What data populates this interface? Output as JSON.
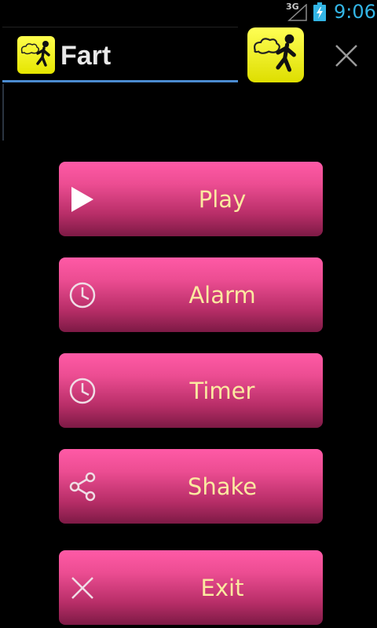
{
  "status_bar": {
    "network": "3G",
    "time": "9:06",
    "signal_icon": "signal-icon",
    "battery_icon": "battery-charging-icon"
  },
  "ad_bar": {
    "title": "Fart",
    "icon": "fart-man-icon",
    "close_icon": "close-icon"
  },
  "menu": {
    "items": [
      {
        "label": "Play",
        "icon": "play-icon"
      },
      {
        "label": "Alarm",
        "icon": "clock-icon"
      },
      {
        "label": "Timer",
        "icon": "clock-icon"
      },
      {
        "label": "Shake",
        "icon": "share-icon"
      },
      {
        "label": "Exit",
        "icon": "close-icon"
      }
    ]
  },
  "colors": {
    "button_top": "#ff5aa6",
    "button_bottom": "#7d1a45",
    "label": "#fbe9a0",
    "clock": "#33b5e5",
    "underline": "#4b8bd0"
  }
}
